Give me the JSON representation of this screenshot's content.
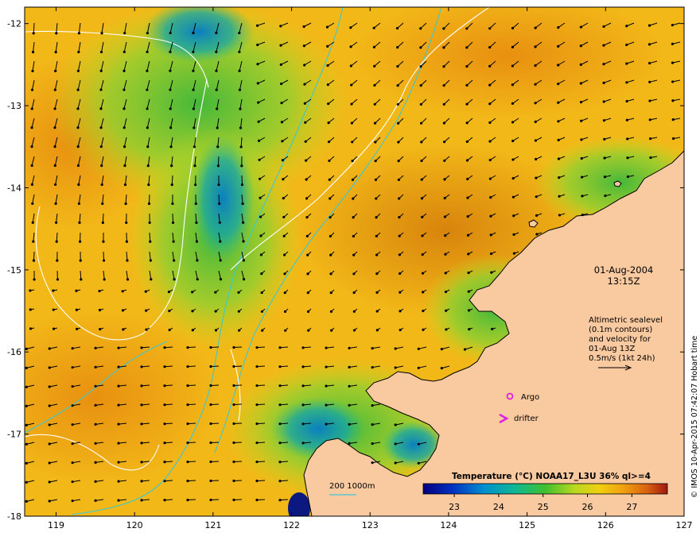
{
  "map": {
    "lon_range": [
      118.6,
      127.0
    ],
    "lat_range": [
      -18.0,
      -11.8
    ],
    "x_ticks": [
      "119",
      "120",
      "121",
      "122",
      "123",
      "124",
      "125",
      "126",
      "127"
    ],
    "y_ticks": [
      "-12",
      "-13",
      "-14",
      "-15",
      "-16",
      "-17",
      "-18"
    ]
  },
  "annotations": {
    "date": "01-Aug-2004",
    "time": "13:15Z",
    "altimetry_lines": [
      "Altimetric sealevel",
      "(0.1m contours)",
      "and velocity for",
      "01-Aug 13Z",
      "0.5m/s (1kt 24h)"
    ],
    "argo_label": "Argo",
    "drifter_label": "drifter",
    "bathy_label": "200  1000m",
    "credit": "© IMOS 10-Apr-2015 07:42:07 Hobart time"
  },
  "colorbar": {
    "title": "Temperature (°C) NOAA17_L3U 36% ql>=4",
    "ticks": [
      "23",
      "24",
      "25",
      "26",
      "27"
    ],
    "range": [
      22.3,
      27.8
    ]
  },
  "colors": {
    "land": "#f9c9a0",
    "sst_warm": "#e89a10",
    "sst_mid": "#f2b918",
    "sst_green": "#6ecb2e",
    "sst_cool": "#0a90c8",
    "argo": "#e020e0",
    "bathy_contour": "#3cc8d2",
    "sealevel_contour": "#ffffff"
  }
}
